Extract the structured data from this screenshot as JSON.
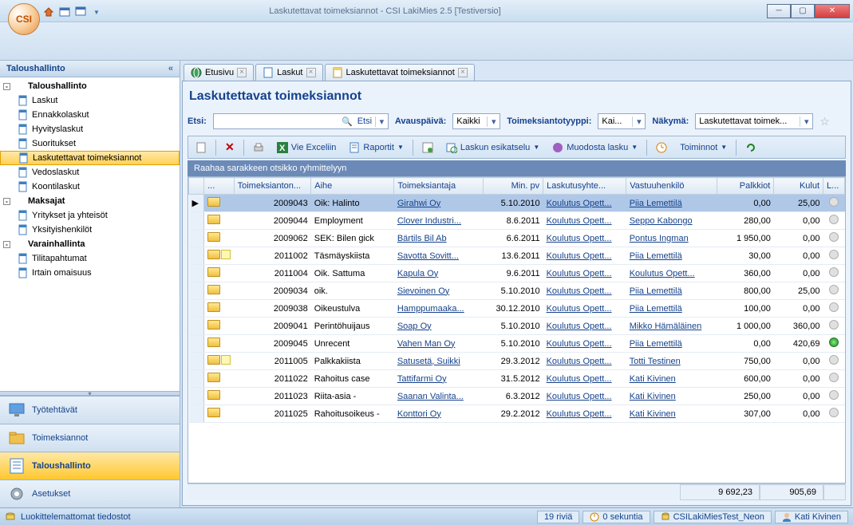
{
  "title": "Laskutettavat toimeksiannot - CSI LakiMies 2.5 [Testiversio]",
  "orb": "CSI",
  "sidebar": {
    "header": "Taloushallinto",
    "tree": [
      {
        "lvl": 0,
        "label": "Taloushallinto",
        "toggle": "-"
      },
      {
        "lvl": 1,
        "label": "Laskut"
      },
      {
        "lvl": 1,
        "label": "Ennakkolaskut"
      },
      {
        "lvl": 1,
        "label": "Hyvityslaskut"
      },
      {
        "lvl": 1,
        "label": "Suoritukset"
      },
      {
        "lvl": 1,
        "label": "Laskutettavat toimeksiannot",
        "selected": true
      },
      {
        "lvl": 1,
        "label": "Vedoslaskut"
      },
      {
        "lvl": 1,
        "label": "Koontilaskut"
      },
      {
        "lvl": 0,
        "label": "Maksajat",
        "toggle": "-"
      },
      {
        "lvl": 1,
        "label": "Yritykset ja yhteisöt"
      },
      {
        "lvl": 1,
        "label": "Yksityishenkilöt"
      },
      {
        "lvl": 0,
        "label": "Varainhallinta",
        "toggle": "-"
      },
      {
        "lvl": 1,
        "label": "Tilitapahtumat"
      },
      {
        "lvl": 1,
        "label": "Irtain omaisuus"
      }
    ],
    "nav": [
      {
        "label": "Työtehtävät",
        "icon": "monitor-icon"
      },
      {
        "label": "Toimeksiannot",
        "icon": "folder-icon"
      },
      {
        "label": "Taloushallinto",
        "icon": "ledger-icon",
        "active": true
      },
      {
        "label": "Asetukset",
        "icon": "gear-icon"
      }
    ]
  },
  "tabs": [
    {
      "label": "Etusivu",
      "icon": "globe-icon"
    },
    {
      "label": "Laskut",
      "icon": "ledger-icon"
    },
    {
      "label": "Laskutettavat toimeksiannot",
      "icon": "doc-icon"
    }
  ],
  "page": {
    "title": "Laskutettavat toimeksiannot",
    "filters": {
      "search_label": "Etsi:",
      "search_btn": "Etsi",
      "avaus_label": "Avauspäivä:",
      "avaus_value": "Kaikki",
      "tyyppi_label": "Toimeksiantotyyppi:",
      "tyyppi_value": "Kai...",
      "nakyma_label": "Näkymä:",
      "nakyma_value": "Laskutettavat toimek..."
    },
    "toolbar": {
      "excel": "Vie Exceliin",
      "raportit": "Raportit",
      "esikatselu": "Laskun esikatselu",
      "muodosta": "Muodosta lasku",
      "toiminnot": "Toiminnot"
    },
    "group_hdr": "Raahaa sarakkeen otsikko ryhmittelyyn",
    "cols": [
      "",
      "...",
      "Toimeksianton...",
      "Aihe",
      "Toimeksiantaja",
      "Min. pv",
      "Laskutusyhte...",
      "Vastuuhenkilö",
      "Palkkiot",
      "Kulut",
      "L..."
    ],
    "rows": [
      {
        "sel": true,
        "note": false,
        "n": "2009043",
        "aihe": "Oik: Halinto",
        "ta": "Girahwi Oy",
        "pv": "5.10.2010",
        "ly": "Koulutus Opett...",
        "vh": "Piia Lemettilä",
        "pk": "0,00",
        "ku": "25,00",
        "st": ""
      },
      {
        "note": false,
        "n": "2009044",
        "aihe": "Employment",
        "ta": "Clover Industri...",
        "pv": "8.6.2011",
        "ly": "Koulutus Opett...",
        "vh": "Seppo Kabongo",
        "pk": "280,00",
        "ku": "0,00",
        "st": ""
      },
      {
        "note": false,
        "n": "2009062",
        "aihe": "SEK: Bilen gick",
        "ta": "Bärtils Bil Ab",
        "pv": "6.6.2011",
        "ly": "Koulutus Opett...",
        "vh": "Pontus Ingman",
        "pk": "1 950,00",
        "ku": "0,00",
        "st": ""
      },
      {
        "note": true,
        "n": "2011002",
        "aihe": "Täsmäyskiista",
        "ta": "Savotta Sovitt...",
        "pv": "13.6.2011",
        "ly": "Koulutus Opett...",
        "vh": "Piia Lemettilä",
        "pk": "30,00",
        "ku": "0,00",
        "st": ""
      },
      {
        "note": false,
        "n": "2011004",
        "aihe": "Oik. Sattuma",
        "ta": "Kapula Oy",
        "pv": "9.6.2011",
        "ly": "Koulutus Opett...",
        "vh": "Koulutus Opett...",
        "pk": "360,00",
        "ku": "0,00",
        "st": ""
      },
      {
        "note": false,
        "n": "2009034",
        "aihe": "oik.",
        "ta": "Sievoinen Oy",
        "pv": "5.10.2010",
        "ly": "Koulutus Opett...",
        "vh": "Piia Lemettilä",
        "pk": "800,00",
        "ku": "25,00",
        "st": ""
      },
      {
        "note": false,
        "n": "2009038",
        "aihe": "Oikeustulva",
        "ta": "Hamppumaaka...",
        "pv": "30.12.2010",
        "ly": "Koulutus Opett...",
        "vh": "Piia Lemettilä",
        "pk": "100,00",
        "ku": "0,00",
        "st": ""
      },
      {
        "note": false,
        "n": "2009041",
        "aihe": "Perintöhuijaus",
        "ta": "Soap Oy",
        "pv": "5.10.2010",
        "ly": "Koulutus Opett...",
        "vh": "Mikko Hämäläinen",
        "pk": "1 000,00",
        "ku": "360,00",
        "st": ""
      },
      {
        "note": false,
        "n": "2009045",
        "aihe": "Unrecent",
        "ta": "Vahen Man Oy",
        "pv": "5.10.2010",
        "ly": "Koulutus Opett...",
        "vh": "Piia Lemettilä",
        "pk": "0,00",
        "ku": "420,69",
        "st": "green"
      },
      {
        "note": true,
        "n": "2011005",
        "aihe": "Palkkakiista",
        "ta": "Satusetä, Suikki",
        "pv": "29.3.2012",
        "ly": "Koulutus Opett...",
        "vh": "Totti Testinen",
        "pk": "750,00",
        "ku": "0,00",
        "st": ""
      },
      {
        "note": false,
        "n": "2011022",
        "aihe": "Rahoitus case",
        "ta": "Tattifarmi Oy",
        "pv": "31.5.2012",
        "ly": "Koulutus Opett...",
        "vh": "Kati Kivinen",
        "pk": "600,00",
        "ku": "0,00",
        "st": ""
      },
      {
        "note": false,
        "n": "2011023",
        "aihe": "Riita-asia -",
        "ta": "Saanan Valinta...",
        "pv": "6.3.2012",
        "ly": "Koulutus Opett...",
        "vh": "Kati Kivinen",
        "pk": "250,00",
        "ku": "0,00",
        "st": ""
      },
      {
        "note": false,
        "n": "2011025",
        "aihe": "Rahoitusoikeus -",
        "ta": "Konttori Oy",
        "pv": "29.2.2012",
        "ly": "Koulutus Opett...",
        "vh": "Kati Kivinen",
        "pk": "307,00",
        "ku": "0,00",
        "st": ""
      }
    ],
    "totals": {
      "pk": "9 692,23",
      "ku": "905,69"
    }
  },
  "statusbar": {
    "left": "Luokittelemattomat tiedostot",
    "rows": "19 riviä",
    "time": "0 sekuntia",
    "db": "CSILakiMiesTest_Neon",
    "user": "Kati Kivinen"
  }
}
